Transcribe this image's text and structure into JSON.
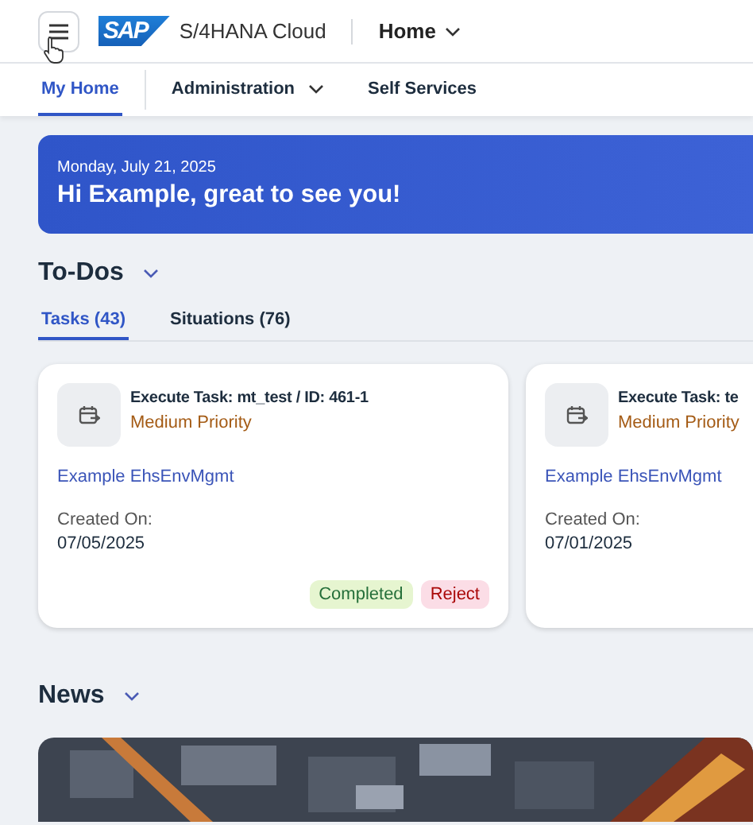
{
  "shell": {
    "logo": "SAP",
    "product": "S/4HANA Cloud",
    "page_menu": "Home"
  },
  "nav": [
    {
      "label": "My Home",
      "selected": true,
      "has_menu": false
    },
    {
      "label": "Administration",
      "selected": false,
      "has_menu": true
    },
    {
      "label": "Self Services",
      "selected": false,
      "has_menu": false
    }
  ],
  "banner": {
    "date": "Monday, July 21, 2025",
    "greeting": "Hi Example, great to see you!"
  },
  "todos": {
    "title": "To-Dos",
    "tabs": [
      {
        "label": "Tasks (43)",
        "selected": true
      },
      {
        "label": "Situations (76)",
        "selected": false
      }
    ],
    "cards": [
      {
        "title": "Execute Task: mt_test / ID: 461-1",
        "priority": "Medium Priority",
        "link": "Example EhsEnvMgmt",
        "created_label": "Created On:",
        "created": "07/05/2025",
        "actions": [
          {
            "label": "Completed",
            "kind": "positive"
          },
          {
            "label": "Reject",
            "kind": "negative"
          }
        ]
      },
      {
        "title": "Execute Task: te",
        "priority": "Medium Priority",
        "link": "Example EhsEnvMgmt",
        "created_label": "Created On:",
        "created": "07/01/2025"
      }
    ]
  },
  "news": {
    "title": "News"
  }
}
